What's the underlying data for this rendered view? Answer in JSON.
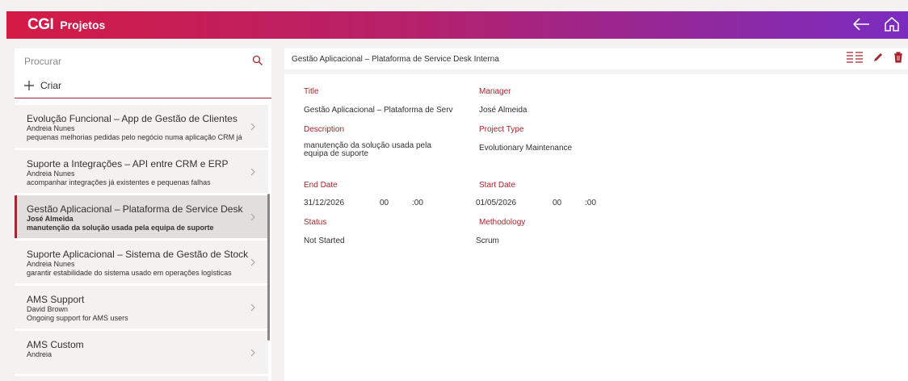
{
  "header": {
    "logo": "CGI",
    "title": "Projetos",
    "icons": [
      "back-arrow-icon",
      "home-icon"
    ]
  },
  "search": {
    "placeholder": "Procurar"
  },
  "create_label": "Criar",
  "projects": [
    {
      "title": "Evolução Funcional – App de Gestão de Clientes",
      "manager": "Andreia Nunes",
      "description": "pequenas melhorias pedidas pelo negócio numa aplicação CRM já",
      "selected": false
    },
    {
      "title": "Suporte a Integrações – API entre CRM e ERP",
      "manager": "Andreia Nunes",
      "description": "acompanhar integrações já existentes e pequenas falhas",
      "selected": false
    },
    {
      "title": "Gestão Aplicacional – Plataforma de Service Desk",
      "manager": "José Almeida",
      "description": "manutenção da solução usada pela equipa de suporte",
      "selected": true
    },
    {
      "title": "Suporte Aplicacional – Sistema de Gestão de Stock",
      "manager": "Andreia Nunes",
      "description": "garantir estabilidade do sistema usado em operações logísticas",
      "selected": false
    },
    {
      "title": "AMS Support",
      "manager": "David Brown",
      "description": "Ongoing support for AMS users",
      "selected": false
    },
    {
      "title": "AMS Custom",
      "manager": "Andreia",
      "description": "",
      "selected": false
    }
  ],
  "detail": {
    "header_title": "Gestão Aplicacional – Plataforma de Service Desk Interna",
    "labels": {
      "title": "Title",
      "manager": "Manager",
      "description": "Description",
      "project_type": "Project Type",
      "end_date": "End Date",
      "start_date": "Start Date",
      "status": "Status",
      "methodology": "Methodology"
    },
    "values": {
      "title": "Gestão Aplicacional – Plataforma de Serv",
      "manager": "José Almeida",
      "description": "manutenção da solução usada pela equipa de suporte",
      "project_type": "Evolutionary Maintenance",
      "end_date": "31/12/2026",
      "end_hour": "00",
      "end_minute": ":00",
      "start_date": "01/05/2026",
      "start_hour": "00",
      "start_minute": ":00",
      "status": "Not Started",
      "methodology": "Scrum"
    }
  },
  "colors": {
    "accent": "#a4262c",
    "gradient_start": "#d31b45",
    "gradient_end": "#7b2cc0"
  }
}
